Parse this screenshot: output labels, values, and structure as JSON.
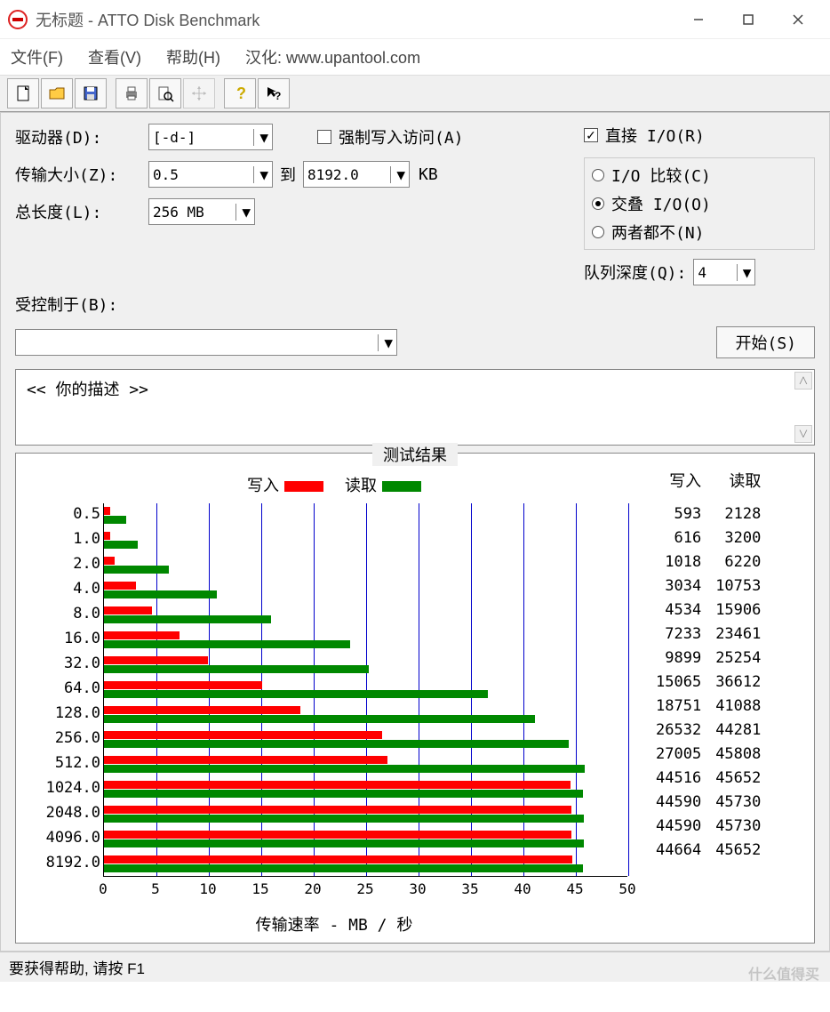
{
  "window": {
    "title": "无标题 - ATTO Disk Benchmark"
  },
  "menu": {
    "file": "文件(F)",
    "view": "查看(V)",
    "help": "帮助(H)",
    "credit": "汉化: www.upantool.com"
  },
  "form": {
    "drive_label": "驱动器(D):",
    "drive_value": "[-d-]",
    "transfer_label": "传输大小(Z):",
    "transfer_from": "0.5",
    "to_label": "到",
    "transfer_to": "8192.0",
    "kb": "KB",
    "length_label": "总长度(L):",
    "length_value": "256 MB",
    "force_write": "强制写入访问(A)",
    "direct_io": "直接 I/O(R)",
    "io_compare": "I/O 比较(C)",
    "overlap_io": "交叠 I/O(O)",
    "neither": "两者都不(N)",
    "queue_label": "队列深度(Q):",
    "queue_value": "4",
    "controlled_label": "受控制于(B):",
    "start_btn": "开始(S)",
    "description": "<<  你的描述   >>"
  },
  "results": {
    "title": "测试结果",
    "write_legend": "写入",
    "read_legend": "读取",
    "xaxis_label": "传输速率 - MB / 秒",
    "write_hdr": "写入",
    "read_hdr": "读取"
  },
  "statusbar": "要获得帮助, 请按 F1",
  "watermark": "什么值得买",
  "chart_data": {
    "type": "bar",
    "categories": [
      "0.5",
      "1.0",
      "2.0",
      "4.0",
      "8.0",
      "16.0",
      "32.0",
      "64.0",
      "128.0",
      "256.0",
      "512.0",
      "1024.0",
      "2048.0",
      "4096.0",
      "8192.0"
    ],
    "series": [
      {
        "name": "写入",
        "values": [
          593,
          616,
          1018,
          3034,
          4534,
          7233,
          9899,
          15065,
          18751,
          26532,
          27005,
          44516,
          44590,
          44590,
          44664
        ]
      },
      {
        "name": "读取",
        "values": [
          2128,
          3200,
          6220,
          10753,
          15906,
          23461,
          25254,
          36612,
          41088,
          44281,
          45808,
          45652,
          45730,
          45730,
          45652
        ]
      }
    ],
    "xlabel": "传输速率 - MB / 秒",
    "xticks": [
      0,
      5,
      10,
      15,
      20,
      25,
      30,
      35,
      40,
      45,
      50
    ],
    "xlim": [
      0,
      50
    ],
    "units": "KB/s (numeric columns), chart bars in MB/s"
  }
}
